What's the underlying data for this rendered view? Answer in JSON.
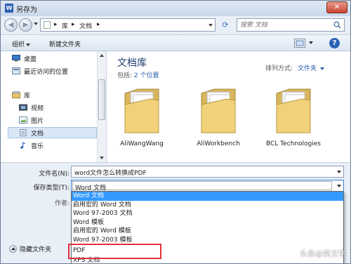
{
  "window": {
    "title": "另存为",
    "app_icon": "word-icon",
    "close_glyph": "✕"
  },
  "navigation": {
    "back_glyph": "◀",
    "forward_glyph": "▶",
    "address": [
      "库",
      "文档"
    ],
    "search_placeholder": "搜索 文档"
  },
  "toolbar": {
    "organize": "组织",
    "new_folder": "新建文件夹"
  },
  "sidebar": {
    "items": [
      {
        "label": "桌面",
        "icon": "desktop-icon"
      },
      {
        "label": "最近访问的位置",
        "icon": "recent-places-icon"
      },
      {
        "label": "库",
        "icon": "libraries-icon"
      },
      {
        "label": "视频",
        "icon": "video-icon"
      },
      {
        "label": "图片",
        "icon": "pictures-icon"
      },
      {
        "label": "文档",
        "icon": "documents-icon",
        "selected": true
      },
      {
        "label": "音乐",
        "icon": "music-icon"
      }
    ]
  },
  "library": {
    "title": "文档库",
    "includes_prefix": "包括:",
    "includes_link": "2 个位置",
    "arrange_label": "排列方式:",
    "arrange_value": "文件夹"
  },
  "folders": [
    {
      "name": "AliWangWang"
    },
    {
      "name": "AliWorkbench"
    },
    {
      "name": "BCL Technologies"
    }
  ],
  "form": {
    "filename_label": "文件名(N):",
    "filename_value": "word文件怎么转换成PDF",
    "type_label": "保存类型(T):",
    "type_value": "Word 文档",
    "author_label": "作者:",
    "hide_folders": "隐藏文件夹"
  },
  "type_options": [
    {
      "label": "Word 文档",
      "highlighted": true
    },
    {
      "label": "启用宏的 Word 文档"
    },
    {
      "label": "Word 97-2003 文档"
    },
    {
      "label": "Word 模板"
    },
    {
      "label": "启用宏的 Word 模板"
    },
    {
      "label": "Word 97-2003 模板"
    },
    {
      "label": "PDF"
    },
    {
      "label": "XPS 文档"
    }
  ],
  "watermark": "头条@笑文学",
  "colors": {
    "highlight": "#3399ff",
    "annotation_box": "#e0303a",
    "link": "#2a5fb0"
  }
}
